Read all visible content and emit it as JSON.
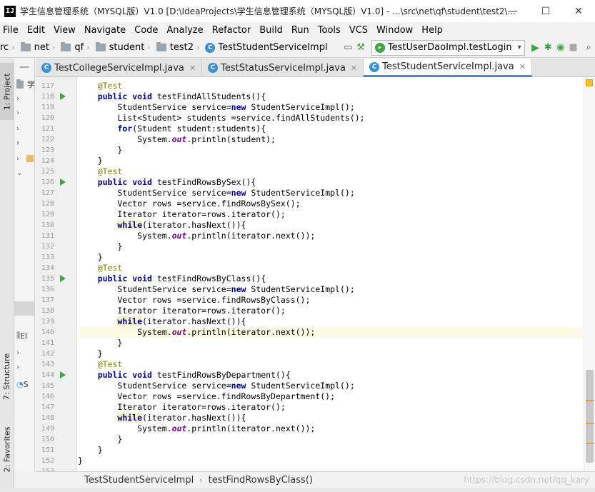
{
  "window": {
    "app_icon": "IJ",
    "title": "学生信息管理系统（MYSQL版）V1.0 [D:\\IdeaProjects\\学生信息管理系统（MYSQL版）V1.0] - ...\\src\\net\\qf\\student\\test2\\...",
    "minimize": "—",
    "maximize": "☐",
    "close": "✕"
  },
  "menu": [
    "File",
    "Edit",
    "View",
    "Navigate",
    "Code",
    "Analyze",
    "Refactor",
    "Build",
    "Run",
    "Tools",
    "VCS",
    "Window",
    "Help"
  ],
  "breadcrumbs": [
    "rc",
    "net",
    "qf",
    "student",
    "test2",
    "TestStudentServiceImpl"
  ],
  "run_config": "TestUserDaoImpl.testLogin",
  "left_tabs": {
    "project": "1: Project",
    "structure": "7: Structure",
    "favorites": "2: Favorites"
  },
  "project_panel": {
    "rows": [
      "学",
      "",
      "",
      "",
      "",
      "",
      "",
      "",
      "",
      "",
      "El",
      "",
      "",
      "S"
    ]
  },
  "tabs": [
    {
      "label": "TestCollegeServiceImpl.java",
      "active": false
    },
    {
      "label": "TestStatusServiceImpl.java",
      "active": false
    },
    {
      "label": "TestStudentServiceImpl.java",
      "active": true
    }
  ],
  "editor": {
    "current_line": 140,
    "lines": [
      {
        "n": "117",
        "code": "    @Test"
      },
      {
        "n": "118",
        "code": "    public void testFindAllStudents(){",
        "run": true
      },
      {
        "n": "119",
        "code": "        StudentService service=new StudentServiceImpl();"
      },
      {
        "n": "120",
        "code": "        List<Student> students =service.findAllStudents();"
      },
      {
        "n": "121",
        "code": "        for(Student student:students){"
      },
      {
        "n": "122",
        "code": "            System.out.println(student);"
      },
      {
        "n": "123",
        "code": "        }"
      },
      {
        "n": "124",
        "code": "    }"
      },
      {
        "n": "125",
        "code": "    @Test"
      },
      {
        "n": "126",
        "code": "    public void testFindRowsBySex(){",
        "run": true
      },
      {
        "n": "127",
        "code": "        StudentService service=new StudentServiceImpl();"
      },
      {
        "n": "128",
        "code": "        Vector rows =service.findRowsBySex();"
      },
      {
        "n": "129",
        "code": "        Iterator iterator=rows.iterator();"
      },
      {
        "n": "130",
        "code": "        while(iterator.hasNext()){"
      },
      {
        "n": "131",
        "code": "            System.out.println(iterator.next());"
      },
      {
        "n": "132",
        "code": "        }"
      },
      {
        "n": "133",
        "code": "    }"
      },
      {
        "n": "134",
        "code": "    @Test"
      },
      {
        "n": "135",
        "code": "    public void testFindRowsByClass(){",
        "run": true
      },
      {
        "n": "136",
        "code": "        StudentService service=new StudentServiceImpl();"
      },
      {
        "n": "137",
        "code": "        Vector rows =service.findRowsByClass();"
      },
      {
        "n": "138",
        "code": "        Iterator iterator=rows.iterator();"
      },
      {
        "n": "139",
        "code": "        while(iterator.hasNext()){"
      },
      {
        "n": "140",
        "code": "            System.out.println(iterator.next());"
      },
      {
        "n": "141",
        "code": "        }"
      },
      {
        "n": "142",
        "code": "    }"
      },
      {
        "n": "143",
        "code": "    @Test"
      },
      {
        "n": "144",
        "code": "    public void testFindRowsByDepartment(){",
        "run": true
      },
      {
        "n": "145",
        "code": "        StudentService service=new StudentServiceImpl();"
      },
      {
        "n": "146",
        "code": "        Vector rows =service.findRowsByDepartment();"
      },
      {
        "n": "147",
        "code": "        Iterator iterator=rows.iterator();"
      },
      {
        "n": "148",
        "code": "        while(iterator.hasNext()){"
      },
      {
        "n": "149",
        "code": "            System.out.println(iterator.next());"
      },
      {
        "n": "150",
        "code": "        }"
      },
      {
        "n": "151",
        "code": "    }"
      },
      {
        "n": "152",
        "code": "}"
      },
      {
        "n": "153",
        "code": ""
      }
    ]
  },
  "status": {
    "class": "TestStudentServiceImpl",
    "method": "testFindRowsByClass()",
    "watermark": "https://blog.csdn.net/qq_kary"
  },
  "colors": {
    "keyword": "#000080",
    "annotation": "#808000",
    "static_field": "#660e7a",
    "run_icon": "#3fa542",
    "active_tab_underline": "#4d89c9",
    "current_line": "#fcfae5"
  }
}
